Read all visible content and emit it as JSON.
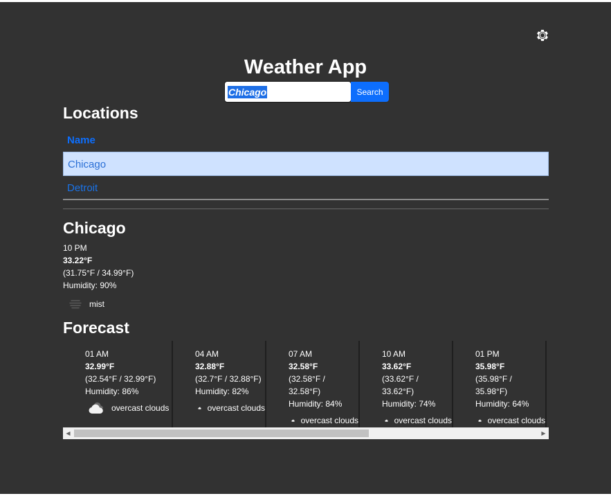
{
  "header": {
    "title": "Weather App",
    "settings_icon": "gear-icon"
  },
  "search": {
    "value": "Chicago",
    "button_label": "Search"
  },
  "locations": {
    "heading": "Locations",
    "column_header": "Name",
    "items": [
      {
        "name": "Chicago",
        "selected": true
      },
      {
        "name": "Detroit",
        "selected": false
      }
    ]
  },
  "current": {
    "city": "Chicago",
    "time": "10 PM",
    "temp": "33.22°F",
    "range": "(31.75°F / 34.99°F)",
    "humidity": "Humidity: 90%",
    "condition": "mist",
    "condition_icon": "mist-icon"
  },
  "forecast": {
    "heading": "Forecast",
    "items": [
      {
        "time": "01 AM",
        "temp": "32.99°F",
        "range": "(32.54°F / 32.99°F)",
        "humidity": "Humidity: 86%",
        "condition": "overcast clouds",
        "icon": "cloud-icon"
      },
      {
        "time": "04 AM",
        "temp": "32.88°F",
        "range": "(32.7°F / 32.88°F)",
        "humidity": "Humidity: 82%",
        "condition": "overcast clouds",
        "icon": "cloud-icon"
      },
      {
        "time": "07 AM",
        "temp": "32.58°F",
        "range": "(32.58°F / 32.58°F)",
        "humidity": "Humidity: 84%",
        "condition": "overcast clouds",
        "icon": "cloud-icon"
      },
      {
        "time": "10 AM",
        "temp": "33.62°F",
        "range": "(33.62°F / 33.62°F)",
        "humidity": "Humidity: 74%",
        "condition": "overcast clouds",
        "icon": "cloud-icon"
      },
      {
        "time": "01 PM",
        "temp": "35.98°F",
        "range": "(35.98°F / 35.98°F)",
        "humidity": "Humidity: 64%",
        "condition": "overcast clouds",
        "icon": "cloud-icon"
      }
    ]
  },
  "colors": {
    "background": "#323232",
    "accent": "#0d6efd",
    "selected_row": "#cfe2ff"
  }
}
